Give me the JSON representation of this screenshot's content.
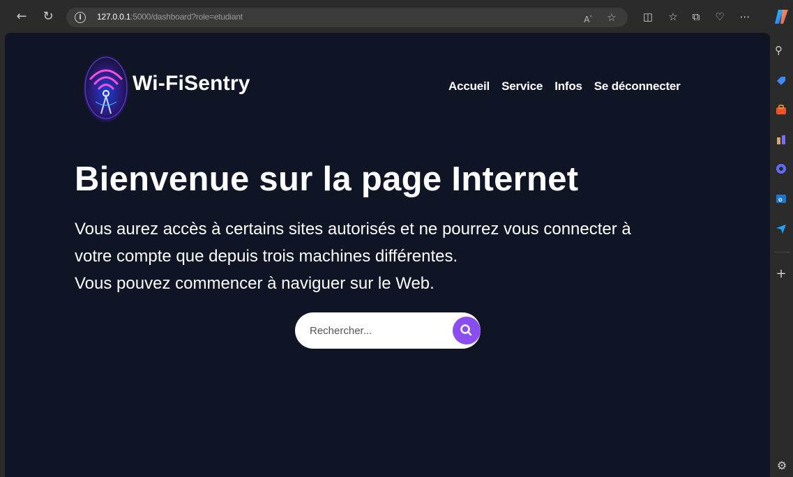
{
  "browser": {
    "url_host": "127.0.0.1",
    "url_rest": ":5000/dashboard?role=etudiant",
    "read_aloud_label": "A⁾"
  },
  "site": {
    "brand": "Wi-FiSentry",
    "nav": [
      "Accueil",
      "Service",
      "Infos",
      "Se déconnecter"
    ]
  },
  "hero": {
    "title": "Bienvenue sur la page Internet",
    "line1": "Vous aurez accès à certains sites autorisés et ne pourrez vous connecter à",
    "line2": "votre compte que depuis trois machines différentes.",
    "line3": "Vous pouvez commencer à naviguer sur le Web."
  },
  "search": {
    "placeholder": "Rechercher..."
  },
  "colors": {
    "page_bg": "#0f1524",
    "accent": "#8a4ef0",
    "chrome": "#2b2b2b"
  }
}
